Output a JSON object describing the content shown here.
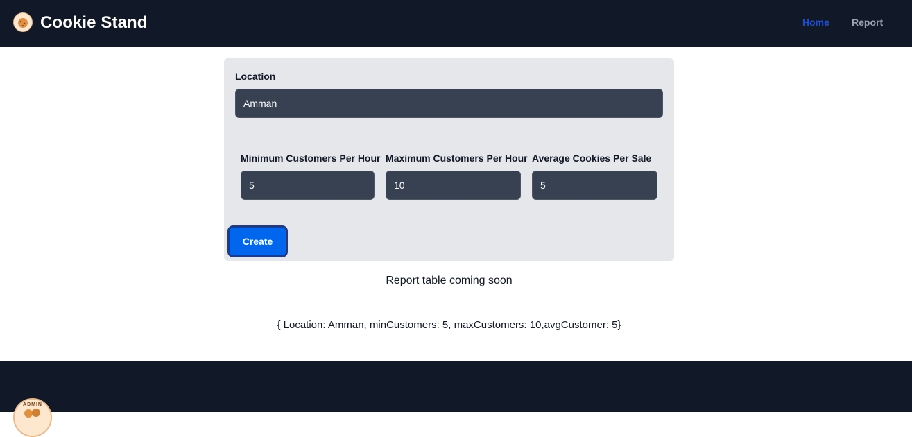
{
  "header": {
    "brand": "Cookie Stand",
    "nav": {
      "home": "Home",
      "report": "Report"
    }
  },
  "form": {
    "location": {
      "label": "Location",
      "value": "Amman"
    },
    "min_customers": {
      "label": "Minimum Customers Per Hour",
      "value": "5"
    },
    "max_customers": {
      "label": "Maximum Customers Per Hour",
      "value": "10"
    },
    "avg_cookies": {
      "label": "Average Cookies Per Sale",
      "value": "5"
    },
    "submit_label": "Create"
  },
  "status_text": "Report table coming soon",
  "summary_text": "{ Location: Amman, minCustomers: 5, maxCustomers: 10,avgCustomer: 5}",
  "footer": {
    "logo_text": "ADMIN"
  },
  "colors": {
    "nav_bg": "#111827",
    "active_link": "#1d4ed8",
    "inactive_link": "#9ca3af",
    "card_bg": "#e5e7eb",
    "input_bg": "#374151",
    "button_bg": "#0066ee",
    "button_border": "#1e3a8a"
  },
  "icons": {
    "brand_logo": "cookie-logo-icon",
    "footer_logo": "admin-cookie-logo-icon"
  }
}
